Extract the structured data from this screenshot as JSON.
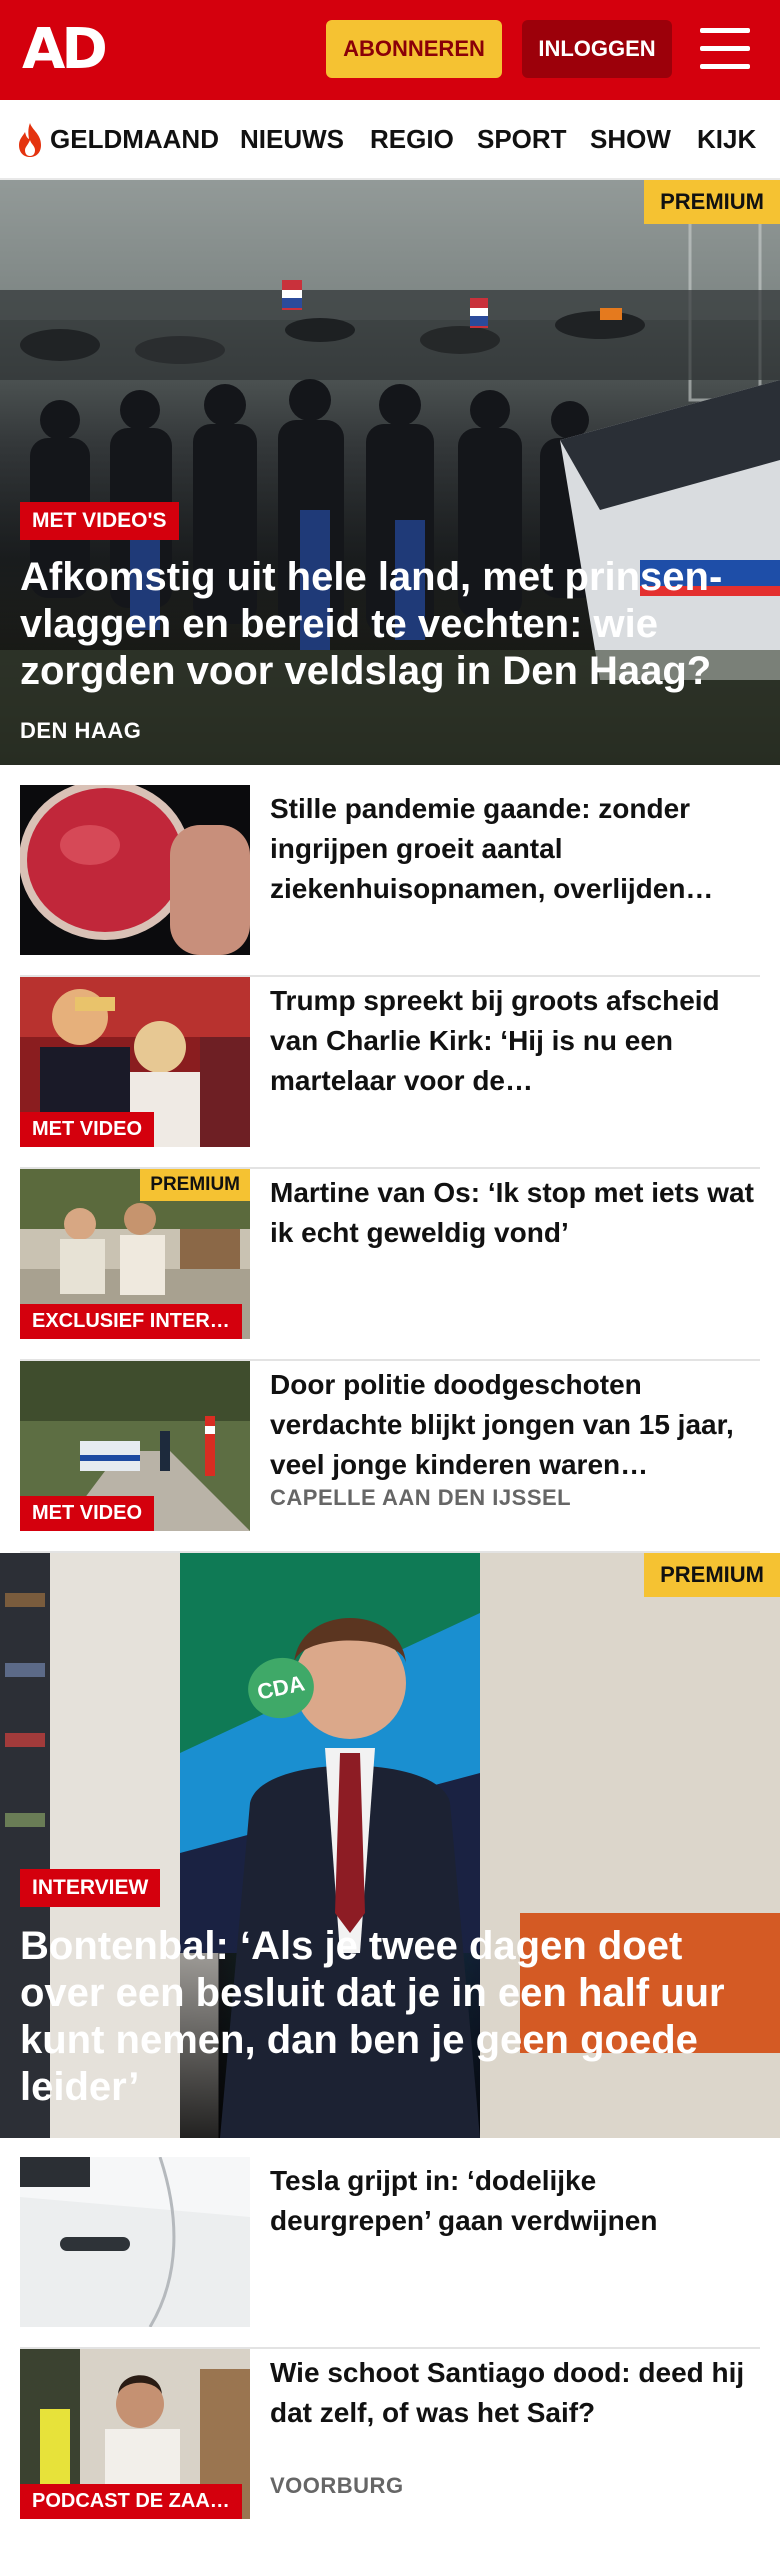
{
  "header": {
    "logo": "AD",
    "subscribe_label": "ABONNEREN",
    "login_label": "INLOGGEN"
  },
  "nav": {
    "items": [
      "GELDMAAND",
      "NIEUWS",
      "REGIO",
      "SPORT",
      "SHOW",
      "KIJK"
    ]
  },
  "hero1": {
    "badge": "PREMIUM",
    "label": "MET VIDEO'S",
    "title": "Afkomstig uit hele land, met prinsen-vlaggen en bereid te vechten: wie zorgden voor veldslag in Den Haag?",
    "location": "DEN HAAG"
  },
  "articles": [
    {
      "title": "Stille pandemie gaande: zonder ingrijpen groeit aantal ziekenhuisopnamen, overlijden…",
      "label": "",
      "badge": "",
      "location": ""
    },
    {
      "title": "Trump spreekt bij groots afscheid van Charlie Kirk: ‘Hij is nu een martelaar voor de…",
      "label": "MET VIDEO",
      "badge": "",
      "location": ""
    },
    {
      "title": "Martine van Os: ‘Ik stop met iets wat ik echt geweldig vond’",
      "label": "EXCLUSIEF INTER…",
      "badge": "PREMIUM",
      "location": ""
    },
    {
      "title": "Door politie doodgeschoten verdachte blijkt jongen van 15 jaar, veel jonge kinderen waren…",
      "label": "MET VIDEO",
      "badge": "",
      "location": "CAPELLE AAN DEN IJSSEL"
    }
  ],
  "hero2": {
    "badge": "PREMIUM",
    "label": "INTERVIEW",
    "title": "Bontenbal: ‘Als je twee dagen doet over een besluit dat je in een half uur kunt nemen, dan ben je geen goede leider’",
    "poster_text": "CDA"
  },
  "articles2": [
    {
      "title": "Tesla grijpt in: ‘dodelijke deurgrepen’ gaan verdwijnen",
      "label": "",
      "location": ""
    },
    {
      "title": "Wie schoot Santiago dood: deed hij dat zelf, of was het Saif?",
      "label": "PODCAST DE ZAA…",
      "location": "VOORBURG"
    }
  ],
  "colors": {
    "brand_red": "#d4000d",
    "premium_yellow": "#f5c232",
    "login_dark_red": "#9c000a"
  },
  "icons": [
    "flame-icon",
    "hamburger-menu-icon"
  ]
}
